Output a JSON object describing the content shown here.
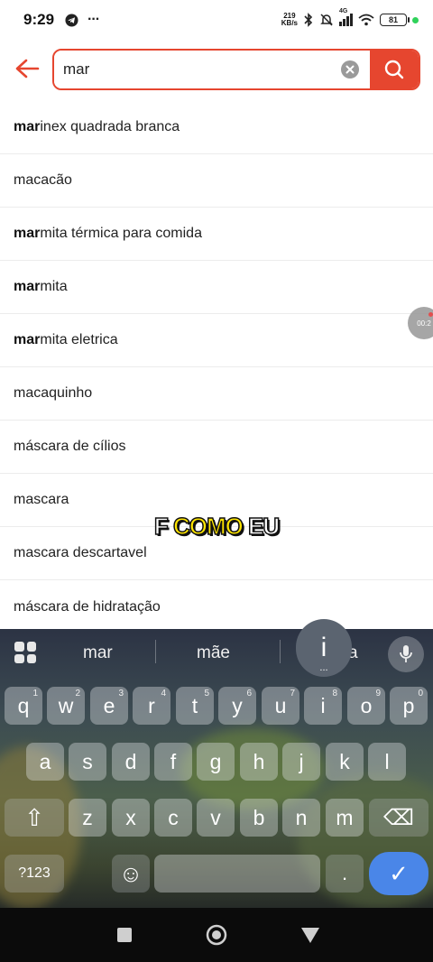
{
  "status_bar": {
    "time": "9:29",
    "more": "···",
    "net_speed_value": "219",
    "net_speed_unit": "KB/s",
    "network": "4G",
    "battery": "81"
  },
  "search": {
    "query": "mar",
    "placeholder": ""
  },
  "suggestions": [
    {
      "bold": "mar",
      "rest": "inex quadrada branca"
    },
    {
      "bold": "",
      "rest": "macacão"
    },
    {
      "bold": "mar",
      "rest": "mita térmica para comida"
    },
    {
      "bold": "mar",
      "rest": "mita"
    },
    {
      "bold": "mar",
      "rest": "mita eletrica"
    },
    {
      "bold": "",
      "rest": "macaquinho"
    },
    {
      "bold": "",
      "rest": "máscara de cílios"
    },
    {
      "bold": "",
      "rest": "mascara"
    },
    {
      "bold": "",
      "rest": "mascara descartavel"
    },
    {
      "bold": "",
      "rest": "máscara de hidratação"
    }
  ],
  "caption": {
    "part1": "F ",
    "part2": "COMO",
    "part3": " EU"
  },
  "recording_bubble": "00:2",
  "keyboard": {
    "word_suggestions": [
      "mar",
      "mãe",
      "a"
    ],
    "popup_key": "i",
    "popup_sub": "...",
    "row1": [
      {
        "k": "q",
        "n": "1"
      },
      {
        "k": "w",
        "n": "2"
      },
      {
        "k": "e",
        "n": "3"
      },
      {
        "k": "r",
        "n": "4"
      },
      {
        "k": "t",
        "n": "5"
      },
      {
        "k": "y",
        "n": "6"
      },
      {
        "k": "u",
        "n": "7"
      },
      {
        "k": "i",
        "n": "8"
      },
      {
        "k": "o",
        "n": "9"
      },
      {
        "k": "p",
        "n": "0"
      }
    ],
    "row2": [
      "a",
      "s",
      "d",
      "f",
      "g",
      "h",
      "j",
      "k",
      "l"
    ],
    "row3": [
      "z",
      "x",
      "c",
      "v",
      "b",
      "n",
      "m"
    ],
    "symbols_label": "?123",
    "period": ".",
    "shift_glyph": "⇧",
    "emoji_glyph": "☺",
    "backspace_glyph": "⌫",
    "enter_glyph": "✓"
  },
  "colors": {
    "accent": "#e6462f",
    "enter_key": "#4a86e8"
  }
}
